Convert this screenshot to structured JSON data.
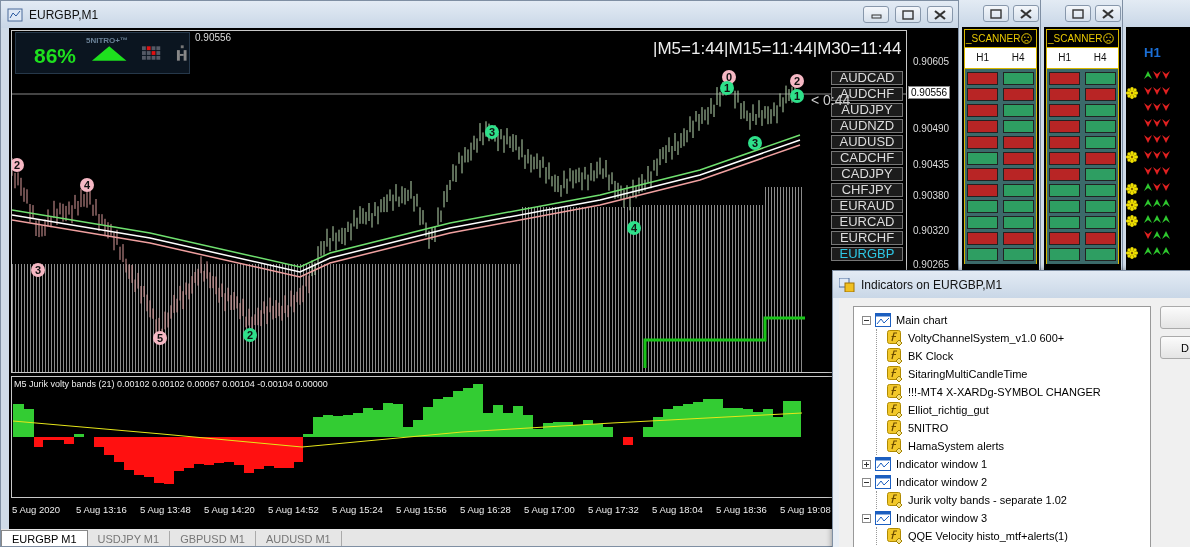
{
  "chart_window": {
    "title": "EURGBP,M1"
  },
  "nitro_panel": {
    "brand": "5NITRO+™",
    "percent": "86%",
    "rising": true
  },
  "header_price": "0.90556",
  "timer_text": "|M5=1:44|M15=11:44|M30=11:44",
  "candle_timer": "< 0:44",
  "wave_labels": [
    {
      "text": "2",
      "color": "#f6b8c4"
    },
    {
      "text": "4",
      "color": "#f6b8c4"
    },
    {
      "text": "3",
      "color": "#f6b8c4"
    },
    {
      "text": "5",
      "color": "#f6b8c4"
    },
    {
      "text": "2",
      "color": "#2ee08a"
    },
    {
      "text": "3",
      "color": "#2ee08a"
    },
    {
      "text": "4",
      "color": "#2ee08a"
    },
    {
      "text": "0",
      "color": "#f6b8c4"
    },
    {
      "text": "1",
      "color": "#2ee08a"
    },
    {
      "text": "3",
      "color": "#2ee08a"
    },
    {
      "text": "2",
      "color": "#f6b8c4"
    },
    {
      "text": "1",
      "color": "#2ee08a"
    }
  ],
  "symbols": [
    {
      "label": "AUDCAD",
      "selected": false
    },
    {
      "label": "AUDCHF",
      "selected": false
    },
    {
      "label": "AUDJPY",
      "selected": false
    },
    {
      "label": "AUDNZD",
      "selected": false
    },
    {
      "label": "AUDUSD",
      "selected": false
    },
    {
      "label": "CADCHF",
      "selected": false
    },
    {
      "label": "CADJPY",
      "selected": false
    },
    {
      "label": "CHFJPY",
      "selected": false
    },
    {
      "label": "EURAUD",
      "selected": false
    },
    {
      "label": "EURCAD",
      "selected": false
    },
    {
      "label": "EURCHF",
      "selected": false
    },
    {
      "label": "EURGBP",
      "selected": true
    }
  ],
  "price_axis": [
    {
      "label": "0.90605",
      "current": false
    },
    {
      "label": "0.90556",
      "current": true
    },
    {
      "label": "0.90490",
      "current": false
    },
    {
      "label": "0.90435",
      "current": false
    },
    {
      "label": "0.90380",
      "current": false
    },
    {
      "label": "0.90320",
      "current": false
    },
    {
      "label": "0.90265",
      "current": false
    }
  ],
  "subwindow": {
    "label": "M5 Jurik volty bands (21) 0.00102 0.00102 0.00067 0.00104 -0.00104 0.00000"
  },
  "time_axis": [
    "5 Aug 2020",
    "5 Aug 13:16",
    "5 Aug 13:48",
    "5 Aug 14:20",
    "5 Aug 14:52",
    "5 Aug 15:24",
    "5 Aug 15:56",
    "5 Aug 16:28",
    "5 Aug 17:00",
    "5 Aug 17:32",
    "5 Aug 18:04",
    "5 Aug 18:36",
    "5 Aug 19:08"
  ],
  "chart_tabs": [
    {
      "label": "EURGBP M1",
      "selected": true
    },
    {
      "label": "USDJPY M1",
      "selected": false
    },
    {
      "label": "GBPUSD M1",
      "selected": false
    },
    {
      "label": "AUDUSD M1",
      "selected": false
    }
  ],
  "scanners": [
    {
      "title": "_SCANNER",
      "columns": [
        "H1",
        "H4"
      ],
      "rows": [
        {
          "cells": [
            {
              "color": "#b82525"
            },
            {
              "color": "#2e9e62"
            }
          ]
        },
        {
          "cells": [
            {
              "color": "#b82525"
            },
            {
              "color": "#b82525"
            }
          ]
        },
        {
          "cells": [
            {
              "color": "#b82525"
            },
            {
              "color": "#2e9e62"
            }
          ]
        },
        {
          "cells": [
            {
              "color": "#b82525"
            },
            {
              "color": "#2e9e62"
            }
          ]
        },
        {
          "cells": [
            {
              "color": "#b82525"
            },
            {
              "color": "#b82525"
            }
          ]
        },
        {
          "cells": [
            {
              "color": "#2e9e62"
            },
            {
              "color": "#b82525"
            }
          ]
        },
        {
          "cells": [
            {
              "color": "#b82525"
            },
            {
              "color": "#b82525"
            }
          ]
        },
        {
          "cells": [
            {
              "color": "#b82525"
            },
            {
              "color": "#2e9e62"
            }
          ]
        },
        {
          "cells": [
            {
              "color": "#2e9e62"
            },
            {
              "color": "#2e9e62"
            }
          ]
        },
        {
          "cells": [
            {
              "color": "#2e9e62"
            },
            {
              "color": "#2e9e62"
            }
          ]
        },
        {
          "cells": [
            {
              "color": "#b82525"
            },
            {
              "color": "#b82525"
            }
          ]
        },
        {
          "cells": [
            {
              "color": "#2e9e62"
            },
            {
              "color": "#2e9e62"
            }
          ]
        }
      ]
    },
    {
      "title": "_SCANNER",
      "columns": [
        "H1",
        "H4"
      ],
      "rows": [
        {
          "cells": [
            {
              "color": "#b82525"
            },
            {
              "color": "#2e9e62"
            }
          ]
        },
        {
          "cells": [
            {
              "color": "#b82525"
            },
            {
              "color": "#b82525"
            }
          ]
        },
        {
          "cells": [
            {
              "color": "#b82525"
            },
            {
              "color": "#2e9e62"
            }
          ]
        },
        {
          "cells": [
            {
              "color": "#b82525"
            },
            {
              "color": "#2e9e62"
            }
          ]
        },
        {
          "cells": [
            {
              "color": "#b82525"
            },
            {
              "color": "#2e9e62"
            }
          ]
        },
        {
          "cells": [
            {
              "color": "#b82525"
            },
            {
              "color": "#b82525"
            }
          ]
        },
        {
          "cells": [
            {
              "color": "#b82525"
            },
            {
              "color": "#2e9e62"
            }
          ]
        },
        {
          "cells": [
            {
              "color": "#2e9e62"
            },
            {
              "color": "#2e9e62"
            }
          ]
        },
        {
          "cells": [
            {
              "color": "#2e9e62"
            },
            {
              "color": "#2e9e62"
            }
          ]
        },
        {
          "cells": [
            {
              "color": "#2e9e62"
            },
            {
              "color": "#2e9e62"
            }
          ]
        },
        {
          "cells": [
            {
              "color": "#b82525"
            },
            {
              "color": "#b82525"
            }
          ]
        },
        {
          "cells": [
            {
              "color": "#2e9e62"
            },
            {
              "color": "#2e9e62"
            }
          ]
        }
      ]
    }
  ],
  "trend_panel": {
    "title": "H1",
    "rows": [
      {
        "alert": false,
        "arrows": [
          {
            "up": true
          },
          {
            "up": false
          },
          {
            "up": false
          }
        ]
      },
      {
        "alert": true,
        "arrows": [
          {
            "up": false
          },
          {
            "up": false
          },
          {
            "up": false
          }
        ]
      },
      {
        "alert": false,
        "arrows": [
          {
            "up": false
          },
          {
            "up": false
          },
          {
            "up": false
          }
        ]
      },
      {
        "alert": false,
        "arrows": [
          {
            "up": false
          },
          {
            "up": false
          },
          {
            "up": false
          }
        ]
      },
      {
        "alert": false,
        "arrows": [
          {
            "up": false
          },
          {
            "up": false
          },
          {
            "up": false
          }
        ]
      },
      {
        "alert": true,
        "arrows": [
          {
            "up": false
          },
          {
            "up": false
          },
          {
            "up": false
          }
        ]
      },
      {
        "alert": false,
        "arrows": [
          {
            "up": false
          },
          {
            "up": false
          },
          {
            "up": false
          }
        ]
      },
      {
        "alert": true,
        "arrows": [
          {
            "up": true
          },
          {
            "up": false
          },
          {
            "up": false
          }
        ]
      },
      {
        "alert": true,
        "arrows": [
          {
            "up": true
          },
          {
            "up": true
          },
          {
            "up": true
          }
        ]
      },
      {
        "alert": true,
        "arrows": [
          {
            "up": true
          },
          {
            "up": true
          },
          {
            "up": true
          }
        ]
      },
      {
        "alert": false,
        "arrows": [
          {
            "up": false
          },
          {
            "up": true
          },
          {
            "up": true
          }
        ]
      },
      {
        "alert": true,
        "arrows": [
          {
            "up": true
          },
          {
            "up": true
          },
          {
            "up": true
          }
        ]
      }
    ]
  },
  "indicators_dialog": {
    "title": "Indicators on EURGBP,M1",
    "tree": [
      {
        "kind": "window",
        "label": "Main chart",
        "expanded": true,
        "children": [
          {
            "kind": "indicator",
            "label": "VoltyChannelSystem_v1.0 600+"
          },
          {
            "kind": "indicator",
            "label": "BK Clock"
          },
          {
            "kind": "indicator",
            "label": "SitaringMultiCandleTime"
          },
          {
            "kind": "indicator",
            "label": "!!!-MT4 X-XARDg-SYMBOL CHANGER"
          },
          {
            "kind": "indicator",
            "label": "Elliot_richtig_gut"
          },
          {
            "kind": "indicator",
            "label": "5NITRO"
          },
          {
            "kind": "indicator",
            "label": "HamaSystem alerts"
          }
        ]
      },
      {
        "kind": "window",
        "label": "Indicator window 1",
        "expanded": false
      },
      {
        "kind": "window",
        "label": "Indicator window 2",
        "expanded": true,
        "children": [
          {
            "kind": "indicator",
            "label": "Jurik volty bands - separate 1.02"
          }
        ]
      },
      {
        "kind": "window",
        "label": "Indicator window 3",
        "expanded": true,
        "children": [
          {
            "kind": "indicator",
            "label": "QQE Velocity histo_mtf+alerts(1)"
          }
        ]
      }
    ],
    "side_buttons": [
      "D"
    ]
  }
}
